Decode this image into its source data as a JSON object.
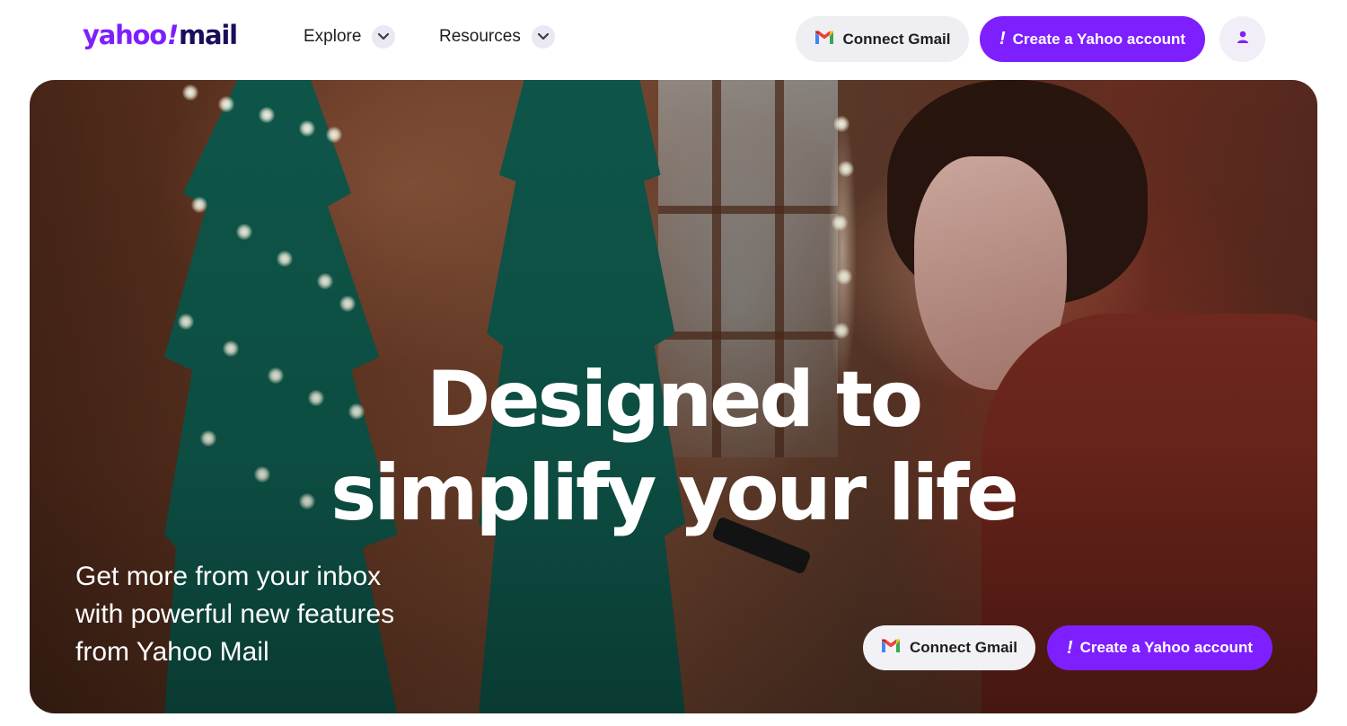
{
  "brand": {
    "logo_yahoo": "yahoo",
    "logo_bang": "!",
    "logo_mail": "mail",
    "accent_color": "#7e1fff",
    "dark_color": "#1b0f5c"
  },
  "nav": {
    "explore_label": "Explore",
    "resources_label": "Resources"
  },
  "header_actions": {
    "connect_gmail_label": "Connect Gmail",
    "create_account_label": "Create a Yahoo account",
    "account_icon": "person-icon"
  },
  "hero": {
    "headline_line1": "Designed to",
    "headline_line2": "simplify your life",
    "subtext_lines": [
      "Get more from your inbox",
      "with powerful new features",
      "from Yahoo Mail"
    ],
    "connect_gmail_label": "Connect Gmail",
    "create_account_label": "Create a Yahoo account"
  }
}
